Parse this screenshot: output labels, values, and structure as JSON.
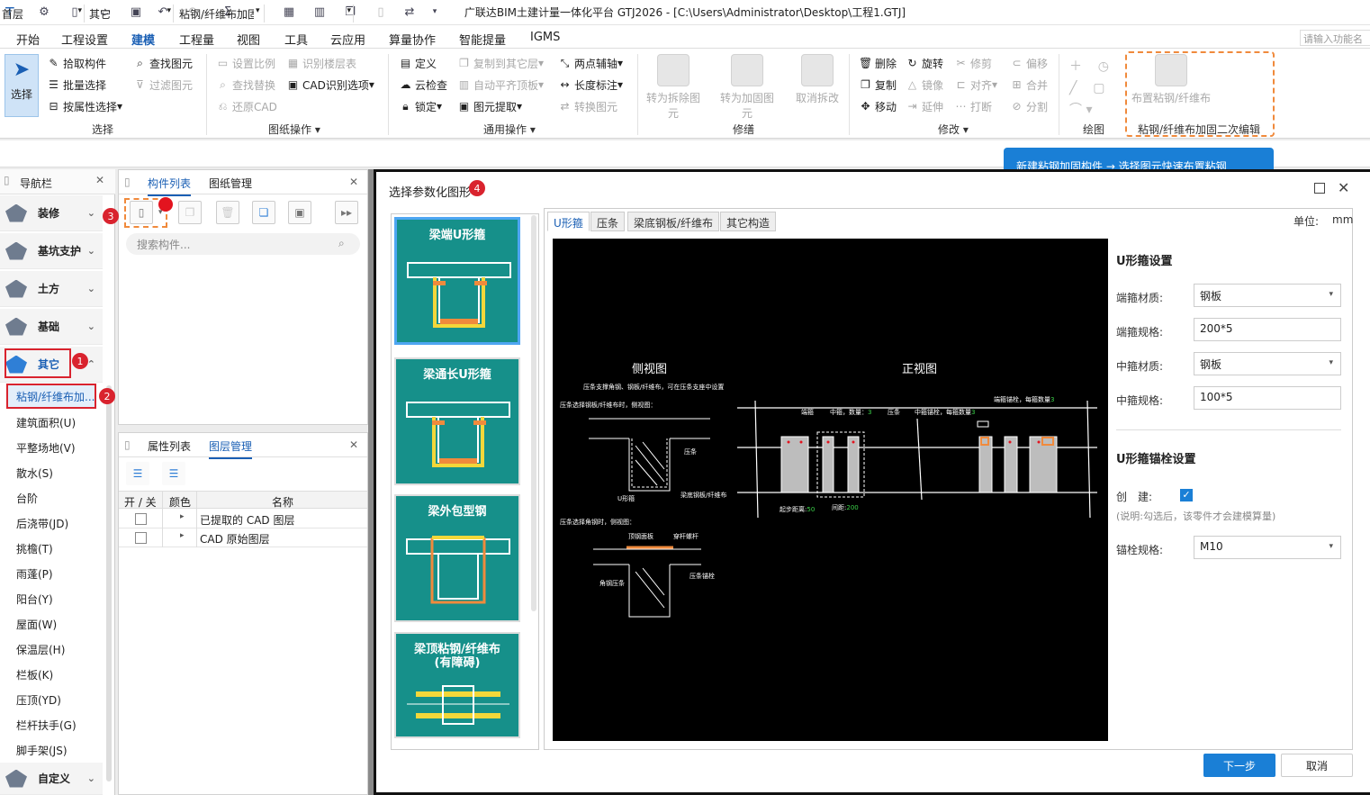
{
  "app": {
    "title": "广联达BIM土建计量一体化平台 GTJ2026 - [C:\\Users\\Administrator\\Desktop\\工程1.GTJ]",
    "search_placeholder": "请输入功能名称"
  },
  "menu": [
    "开始",
    "工程设置",
    "建模",
    "工程量",
    "视图",
    "工具",
    "云应用",
    "算量协作",
    "智能提量",
    "IGMS"
  ],
  "menu_active": "建模",
  "ribbon": {
    "select": {
      "label": "选择",
      "items": [
        "拾取构件",
        "批量选择",
        "按属性选择"
      ],
      "group": "选择"
    },
    "drawing_ops": {
      "items": [
        "查找图元",
        "过滤图元",
        "设置比例",
        "查找替换",
        "还原CAD",
        "识别楼层表",
        "CAD识别选项"
      ],
      "group": "图纸操作"
    },
    "general_ops": {
      "items": [
        "定义",
        "云检查",
        "锁定",
        "复制到其它层",
        "自动平齐顶板",
        "图元提取",
        "两点辅轴",
        "长度标注",
        "转换图元"
      ],
      "group": "通用操作"
    },
    "repair": {
      "items": [
        "转为拆除图元",
        "转为加固图元",
        "取消拆改"
      ],
      "group": "修缮"
    },
    "modify": {
      "items": [
        "删除",
        "复制",
        "移动",
        "旋转",
        "镜像",
        "延伸",
        "修剪",
        "对齐",
        "打断",
        "偏移",
        "合并",
        "分割"
      ],
      "group": "修改"
    },
    "draw": {
      "group": "绘图"
    },
    "bonded": {
      "label": "布置粘钢/纤维布",
      "group": "粘钢/纤维布加固二次编辑"
    }
  },
  "floorbar": {
    "floor": "首层",
    "type": "其它",
    "component": "粘钢/纤维布加固"
  },
  "tooltip": "新建粘钢加固构件 → 选择图元快速布置粘钢",
  "nav": {
    "title": "导航栏",
    "categories": [
      "装修",
      "基坑支护",
      "土方",
      "基础",
      "其它",
      "自定义"
    ],
    "subitems": [
      "粘钢/纤维布加...",
      "建筑面积(U)",
      "平整场地(V)",
      "散水(S)",
      "台阶",
      "后浇带(JD)",
      "挑檐(T)",
      "雨蓬(P)",
      "阳台(Y)",
      "屋面(W)",
      "保温层(H)",
      "栏板(K)",
      "压顶(YD)",
      "栏杆扶手(G)",
      "脚手架(JS)"
    ]
  },
  "component_panel": {
    "tabs": [
      "构件列表",
      "图纸管理"
    ],
    "search_placeholder": "搜索构件..."
  },
  "property_panel": {
    "tabs": [
      "属性列表",
      "图层管理"
    ],
    "headers": [
      "开 / 关",
      "颜色",
      "名称"
    ],
    "rows": [
      "已提取的 CAD 图层",
      "CAD 原始图层"
    ]
  },
  "badges": [
    "1",
    "2",
    "3",
    "4"
  ],
  "dialog": {
    "title": "选择参数化图形",
    "thumbs": [
      "梁端U形箍",
      "梁通长U形箍",
      "梁外包型钢",
      "梁顶粘钢/纤维布\n(有障碍)"
    ],
    "tabs": [
      "U形箍",
      "压条",
      "梁底钢板/纤维布",
      "其它构造"
    ],
    "unit_label": "单位:",
    "unit": "mm",
    "canvas": {
      "side_title": "侧视图",
      "front_title": "正视图",
      "note1": "压条支撑角钢、钢板/纤维布，可在压条支座中设置",
      "note2": "压条选择钢板/纤维布时，侧视图：",
      "note3": "压条选择角钢时，侧视图：",
      "lbl_yatiao": "压条",
      "lbl_u": "U形箍",
      "lbl_bottom": "梁底钢板/纤维布",
      "lbl_top": "顶钢面板",
      "lbl_bolt": "穿杆螺杆",
      "lbl_angle": "角钢压条",
      "lbl_anchor": "压条锚栓",
      "lbl_end": "端箍",
      "lbl_mid": "中箍，数量：",
      "lbl_mid_val": "3",
      "lbl_strip": "压条",
      "lbl_midbolt": "中箍锚栓，每箍数量",
      "lbl_midbolt_val": "3",
      "lbl_endbolt": "端箍锚栓，每箍数量",
      "lbl_endbolt_val": "3",
      "lbl_start": "起步距离",
      "lbl_start_val": "50",
      "lbl_space": "间距",
      "lbl_space_val": "200"
    },
    "settings": {
      "u_title": "U形箍设置",
      "end_mat": "端箍材质:",
      "end_mat_val": "钢板",
      "end_spec": "端箍规格:",
      "end_spec_val": "200*5",
      "mid_mat": "中箍材质:",
      "mid_mat_val": "钢板",
      "mid_spec": "中箍规格:",
      "mid_spec_val": "100*5",
      "anchor_title": "U形箍锚栓设置",
      "create": "创　建:",
      "create_note": "(说明:勾选后，该零件才会建模算量)",
      "bolt_spec": "锚栓规格:",
      "bolt_spec_val": "M10"
    },
    "next": "下一步",
    "cancel": "取消"
  }
}
